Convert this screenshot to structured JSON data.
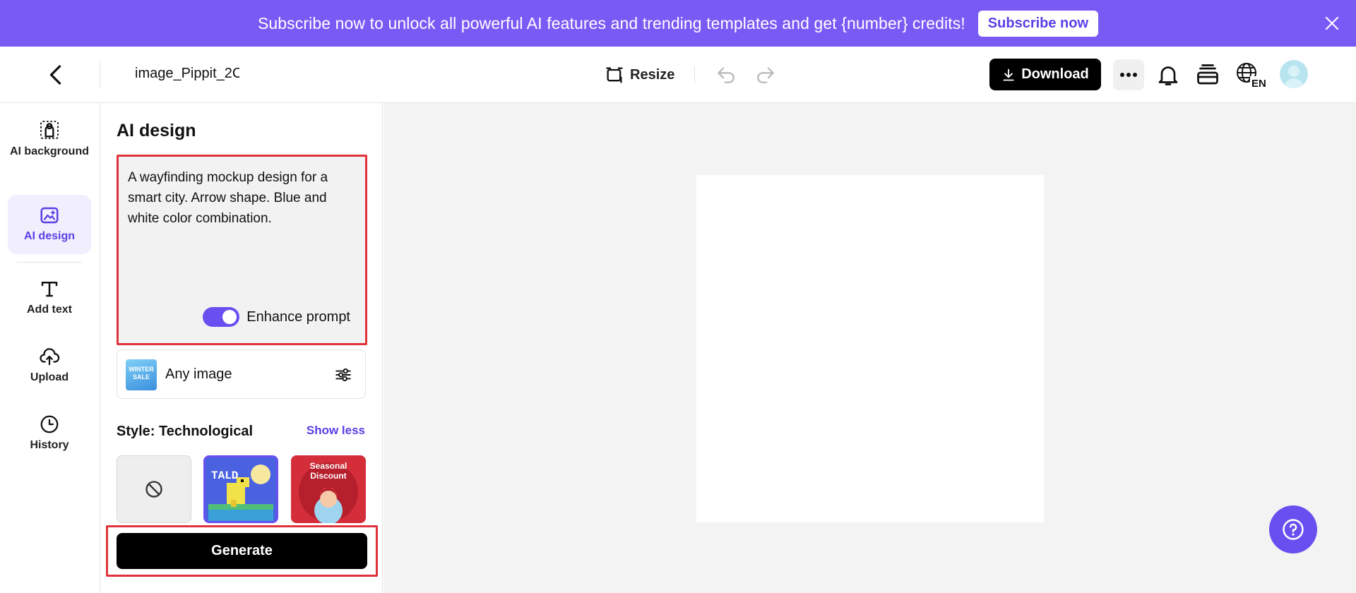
{
  "banner": {
    "text": "Subscribe now to unlock all powerful AI features and trending templates and get {number} credits!",
    "button_label": "Subscribe now",
    "color": "#7a5af5"
  },
  "topbar": {
    "file_name": "image_Pippit_2C",
    "resize_label": "Resize",
    "download_label": "Download",
    "language_badge": "EN"
  },
  "nav": {
    "items": [
      {
        "label": "AI background",
        "icon": "ai-background-icon"
      },
      {
        "label": "AI design",
        "icon": "ai-design-icon",
        "active": true
      },
      {
        "label": "Add text",
        "icon": "text-icon"
      },
      {
        "label": "Upload",
        "icon": "upload-icon"
      },
      {
        "label": "History",
        "icon": "history-icon"
      }
    ]
  },
  "panel": {
    "title": "AI design",
    "prompt": "A wayfinding mockup design for a smart city. Arrow shape. Blue and white color combination.",
    "enhance_label": "Enhance prompt",
    "enhance_on": true,
    "any_image_label": "Any image",
    "any_image_thumb_text": "WINTER SALE",
    "style_label": "Style: Technological",
    "show_less_label": "Show less",
    "tiles": [
      {
        "name": "none",
        "icon": "ban-icon"
      },
      {
        "name": "technological",
        "selected": true,
        "text": "TALD"
      },
      {
        "name": "seasonal",
        "text": "Seasonal Discount"
      }
    ],
    "generate_label": "Generate"
  },
  "colors": {
    "accent": "#6a4ff0",
    "highlight": "#e0323a"
  }
}
